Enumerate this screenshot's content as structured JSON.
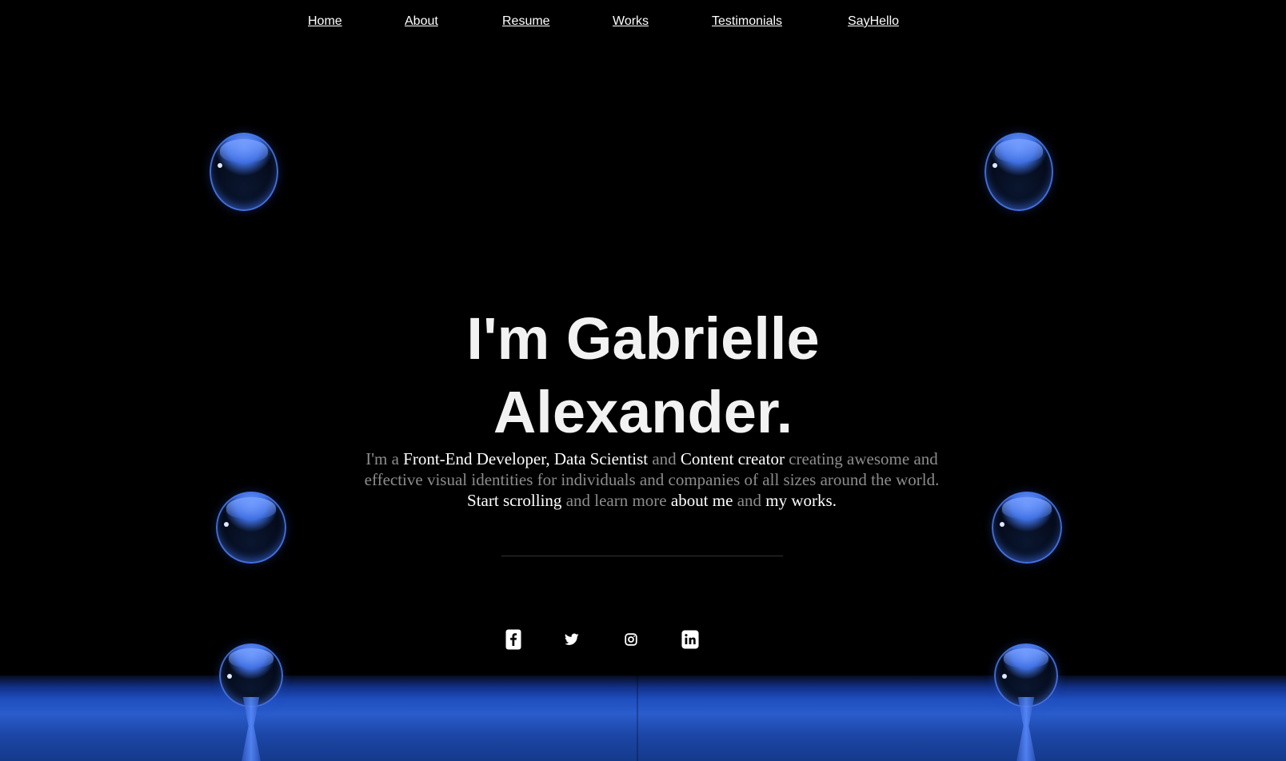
{
  "nav": {
    "items": [
      {
        "label": "Home"
      },
      {
        "label": "About"
      },
      {
        "label": "Resume"
      },
      {
        "label": "Works"
      },
      {
        "label": "Testimonials"
      },
      {
        "label": "SayHello"
      }
    ]
  },
  "hero": {
    "title_line1": "I'm Gabrielle",
    "title_line2": "Alexander."
  },
  "intro": {
    "p1": "I'm a ",
    "role1": "Front-End Developer, Data Scientist",
    "p2": " and ",
    "role2": "Content creator",
    "p3": " creating awesome and effective visual identities for individuals and companies of all sizes around the world. ",
    "link_scroll": "Start scrolling",
    "p4": " and learn more ",
    "link_about": "about me",
    "p5": " and ",
    "link_works": "my works."
  },
  "socials": [
    {
      "icon": "facebook-icon"
    },
    {
      "icon": "twitter-icon"
    },
    {
      "icon": "instagram-icon"
    },
    {
      "icon": "linkedin-icon"
    }
  ],
  "colors": {
    "background": "#000000",
    "text": "#ffffff",
    "muted_text": "#8c8c8c",
    "accent_blue": "#2a5ccc"
  }
}
